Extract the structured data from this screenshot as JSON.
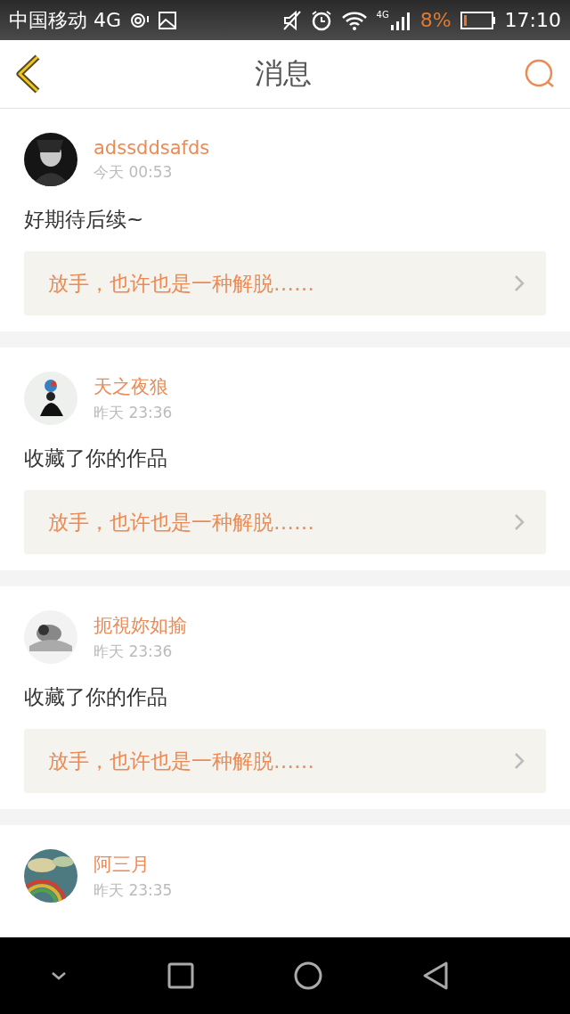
{
  "status_bar": {
    "carrier": "中国移动 4G",
    "network": "4G",
    "battery": "8%",
    "time": "17:10"
  },
  "header": {
    "title": "消息"
  },
  "messages": [
    {
      "user": "adssddsafds",
      "time": "今天 00:53",
      "text": "好期待后续~",
      "quote": "放手，也许也是一种解脱……"
    },
    {
      "user": "天之夜狼",
      "time": "昨天 23:36",
      "text": "收藏了你的作品",
      "quote": "放手，也许也是一种解脱……"
    },
    {
      "user": "扼視妳如揄",
      "time": "昨天 23:36",
      "text": "收藏了你的作品",
      "quote": "放手，也许也是一种解脱……"
    },
    {
      "user": "阿三月",
      "time": "昨天 23:35"
    }
  ]
}
